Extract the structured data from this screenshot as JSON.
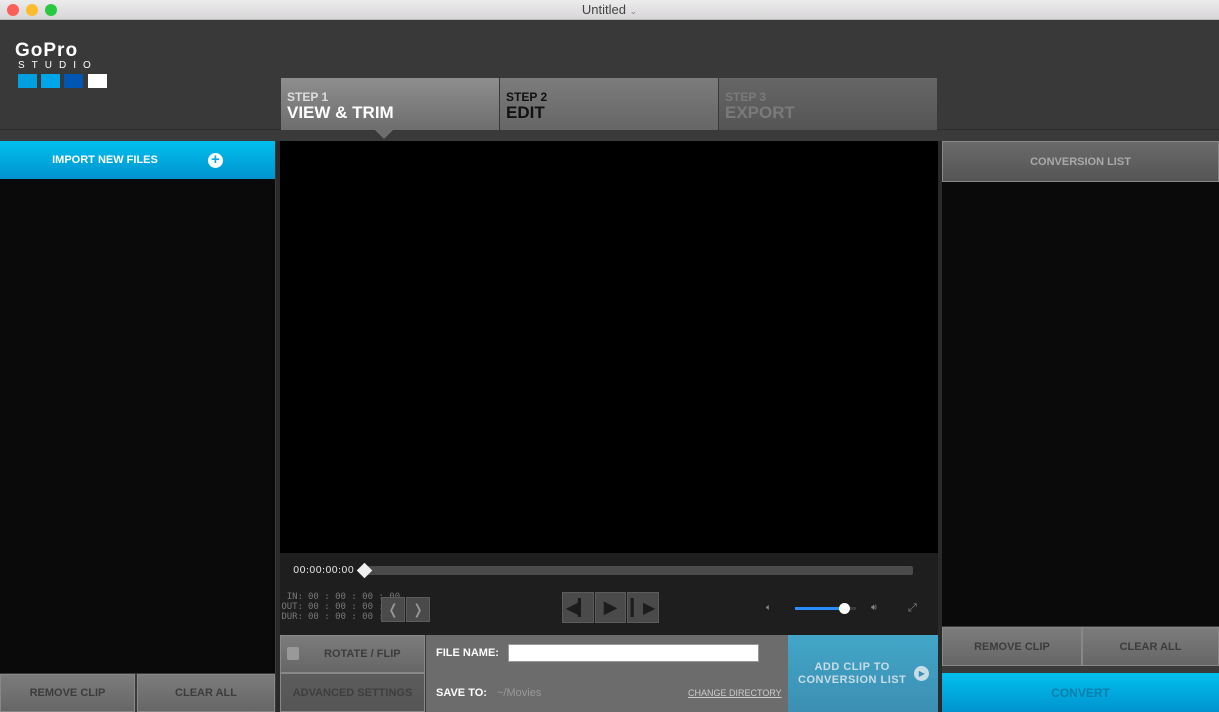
{
  "window": {
    "title": "Untitled"
  },
  "logo": {
    "brand": "GoPro",
    "product": "STUDIO",
    "colors": [
      "#00a0e0",
      "#00a6ea",
      "#0056b3",
      "#ffffff"
    ]
  },
  "steps": [
    {
      "step": "STEP 1",
      "label": "VIEW & TRIM",
      "state": "active"
    },
    {
      "step": "STEP 2",
      "label": "EDIT",
      "state": "inactive"
    },
    {
      "step": "STEP 3",
      "label": "EXPORT",
      "state": "disabled"
    }
  ],
  "left": {
    "import_label": "IMPORT NEW FILES",
    "remove_clip": "REMOVE CLIP",
    "clear_all": "CLEAR ALL"
  },
  "player": {
    "timecode": "00:00:00:00",
    "in_label": "IN:",
    "in": "00 : 00 : 00 : 00",
    "out_label": "OUT:",
    "out": "00 : 00 : 00 : 00",
    "dur_label": "DUR:",
    "dur": "00 : 00 : 00 : 00",
    "volume_percent": 80
  },
  "bottom": {
    "rotate_flip": "ROTATE / FLIP",
    "advanced_settings": "ADVANCED SETTINGS",
    "file_name_label": "FILE NAME:",
    "file_name_value": "",
    "save_to_label": "SAVE TO:",
    "save_to_value": "~/Movies",
    "change_directory": "CHANGE DIRECTORY",
    "add_clip_line1": "ADD CLIP TO",
    "add_clip_line2": "CONVERSION LIST"
  },
  "right": {
    "header": "CONVERSION LIST",
    "remove_clip": "REMOVE CLIP",
    "clear_all": "CLEAR ALL",
    "convert": "CONVERT"
  },
  "colors": {
    "accent": "#00b4e8"
  }
}
